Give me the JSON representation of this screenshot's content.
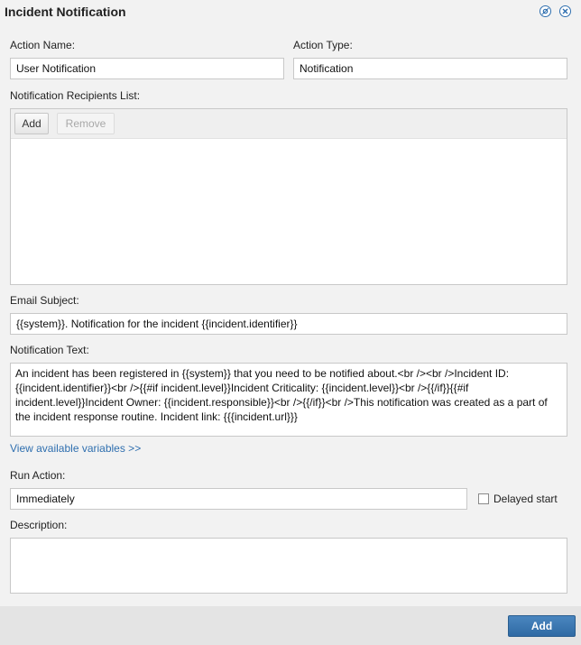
{
  "dialog": {
    "title": "Incident Notification"
  },
  "icons": {
    "settings": "settings-icon",
    "close": "close-icon",
    "accent": "#2f6faf"
  },
  "form": {
    "action_name": {
      "label": "Action Name:",
      "value": "User Notification"
    },
    "action_type": {
      "label": "Action Type:",
      "value": "Notification"
    },
    "recipients": {
      "label": "Notification Recipients List:",
      "add_label": "Add",
      "remove_label": "Remove",
      "items": []
    },
    "email_subject": {
      "label": "Email Subject:",
      "value": "{{system}}. Notification for the incident {{incident.identifier}}"
    },
    "notification_text": {
      "label": "Notification Text:",
      "value": "An incident has been registered in {{system}} that you need to be notified about.<br /><br />Incident ID: {{incident.identifier}}<br />{{#if incident.level}}Incident Criticality: {{incident.level}}<br />{{/if}}{{#if incident.level}}Incident Owner: {{incident.responsible}}<br />{{/if}}<br />This notification was created as a part of the incident response routine. Incident link: {{{incident.url}}}"
    },
    "variables_link": "View available variables >>",
    "run_action": {
      "label": "Run Action:",
      "value": "Immediately",
      "delayed_label": "Delayed start",
      "delayed_checked": false
    },
    "description": {
      "label": "Description:",
      "value": ""
    }
  },
  "footer": {
    "add_label": "Add"
  }
}
